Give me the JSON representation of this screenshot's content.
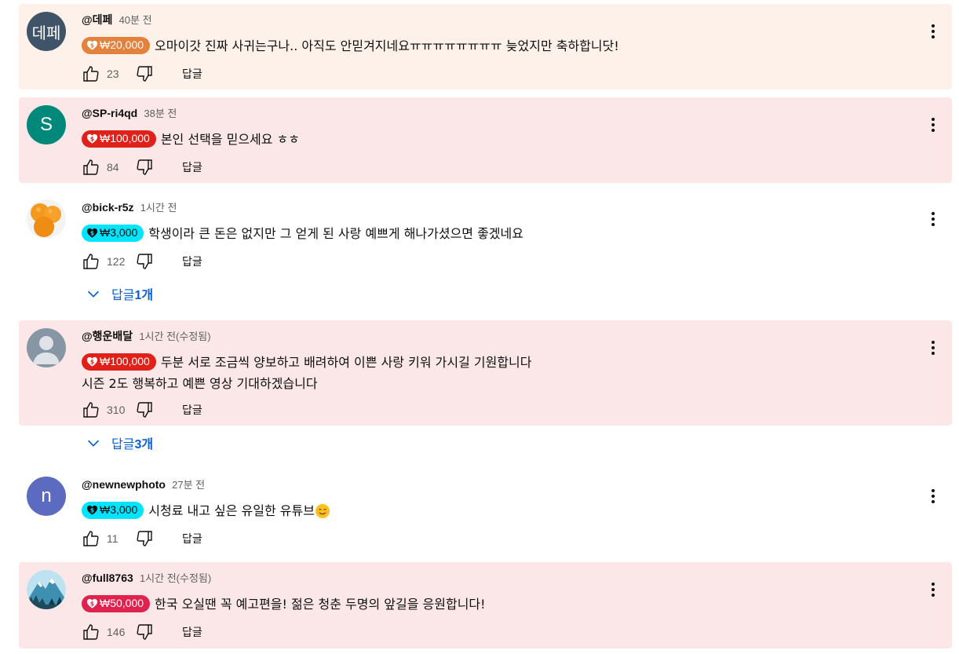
{
  "reply_label": "답글",
  "comments": [
    {
      "avatar_text": "데페",
      "author": "@데페",
      "time": "40분 전",
      "amount": "₩20,000",
      "text": "오마이갓 진짜 사귀는구나.. 아직도 안믿겨지네요ㅠㅠㅠㅠㅠㅠㅠㅠ 늦었지만 축하합니닷!",
      "likes": "23",
      "colors": {
        "background": "#fdf1e9",
        "badge": "#e2823c"
      }
    },
    {
      "avatar_text": "S",
      "author": "@SP-ri4qd",
      "time": "38분 전",
      "amount": "₩100,000",
      "text": "본인 선택을 믿으세요 ㅎㅎ",
      "likes": "84",
      "colors": {
        "background": "#fbe7e7",
        "badge": "#e02119"
      }
    },
    {
      "avatar_text": "",
      "author": "@bick-r5z",
      "time": "1시간 전",
      "amount": "₩3,000",
      "text": "학생이라 큰 돈은 없지만 그 얻게 된 사랑 예쁘게 해나가셨으면 좋겠네요",
      "likes": "122",
      "replies": {
        "prefix": "답글 ",
        "count": "1개"
      },
      "colors": {
        "background": "#ffffff",
        "badge": "#00e5ff"
      }
    },
    {
      "avatar_text": "",
      "author": "@행운배달",
      "time": "1시간 전(수정됨)",
      "amount": "₩100,000",
      "text": "두분 서로 조금씩 양보하고 배려하여 이쁜 사랑 키워 가시길 기원합니다",
      "text2": "시즌 2도 행복하고 예쁜 영상 기대하겠습니다",
      "likes": "310",
      "replies": {
        "prefix": "답글 ",
        "count": "3개"
      },
      "colors": {
        "background": "#fbe7e7",
        "badge": "#e02119"
      }
    },
    {
      "avatar_text": "n",
      "author": "@newnewphoto",
      "time": "27분 전",
      "amount": "₩3,000",
      "text": "시청료 내고 싶은 유일한 유튜브",
      "likes": "11",
      "colors": {
        "background": "#ffffff",
        "badge": "#00e5ff"
      }
    },
    {
      "avatar_text": "",
      "author": "@full8763",
      "time": "1시간 전(수정됨)",
      "amount": "₩50,000",
      "text": "한국 오실땐 꼭 예고편을! 젊은 청춘 두명의 앞길을 응원합니다!",
      "likes": "146",
      "colors": {
        "background": "#fbe7e7",
        "badge": "#e0234e"
      }
    }
  ]
}
